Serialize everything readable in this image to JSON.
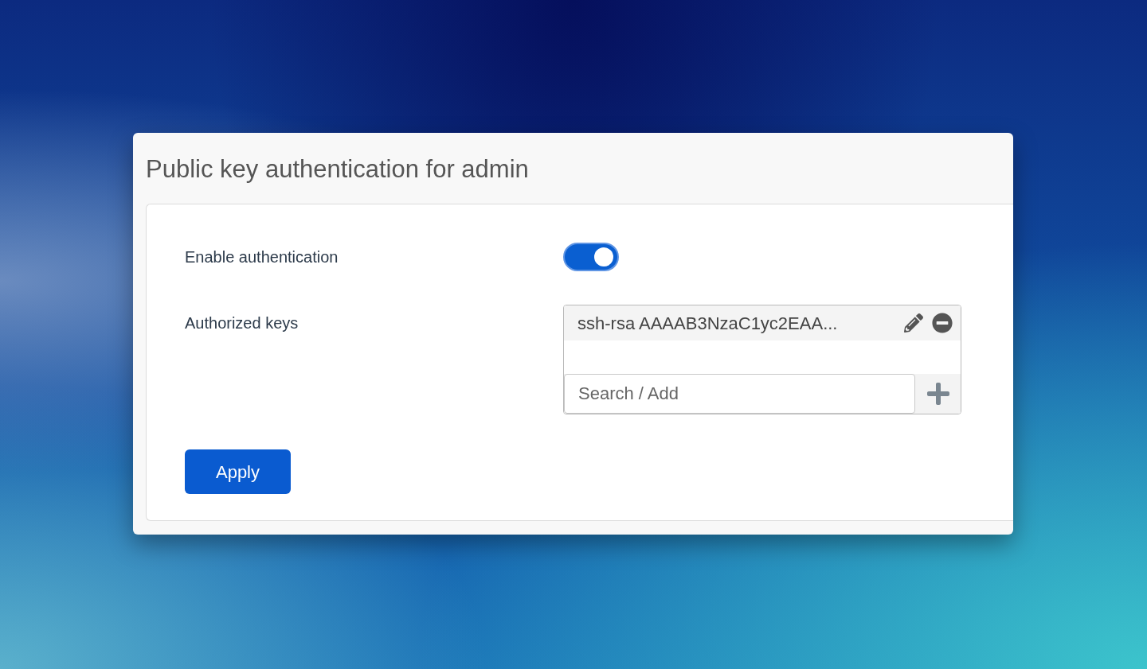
{
  "dialog": {
    "title": "Public key authentication for admin"
  },
  "settings": [
    {
      "kind": "toggle",
      "label": "Enable authentication",
      "on": true
    },
    {
      "kind": "key_list",
      "label": "Authorized keys",
      "keys": [
        "ssh-rsa AAAAB3NzaC1yc2EAA..."
      ],
      "search": {
        "placeholder": "Search / Add"
      }
    }
  ],
  "buttons": [
    {
      "label": "Apply"
    }
  ]
}
